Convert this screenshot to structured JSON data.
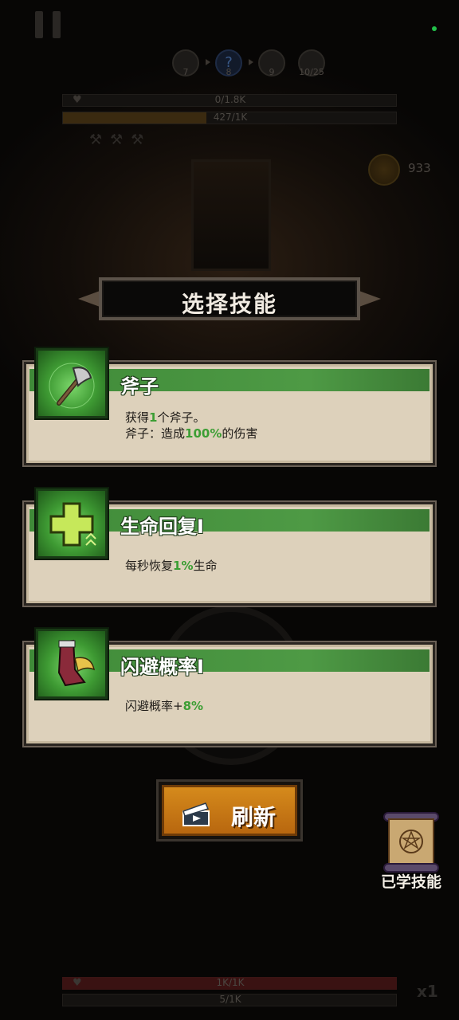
{
  "hud": {
    "stages": [
      {
        "icon": "crossed-swords-icon",
        "num": "7"
      },
      {
        "icon": "question-mark-icon",
        "num": "8",
        "glyph": "?"
      },
      {
        "icon": "crossed-swords-icon",
        "num": "9"
      },
      {
        "icon": "skull-icon",
        "num": "10/25"
      }
    ],
    "enemy_hp": "0/1.8K",
    "enemy_exp": "427/1K",
    "exp_fraction": 0.43,
    "coins": "933",
    "player_hp": "1K/1K",
    "player_xp": "5/1K",
    "speed": "x1"
  },
  "dialog": {
    "title": "选择技能",
    "skills": [
      {
        "name": "斧子",
        "icon": "axe-icon",
        "line1": {
          "a": "获得",
          "b": "1",
          "c": "个斧子。"
        },
        "line2": {
          "a": "斧子：造成",
          "b": "100%",
          "c": "的伤害"
        }
      },
      {
        "name": "生命回复I",
        "icon": "health-cross-icon",
        "line1": {
          "a": "每秒恢复",
          "b": "1%",
          "c": "生命"
        }
      },
      {
        "name": "闪避概率I",
        "icon": "winged-boot-icon",
        "line1": {
          "a": "闪避概率+",
          "b": "8%",
          "c": ""
        }
      }
    ],
    "refresh_label": "刷新",
    "learned_label": "已学技能"
  },
  "colors": {
    "accent_green": "#3c9e34",
    "refresh_orange": "#d58a1c",
    "card_bg": "#ddd1bb"
  }
}
